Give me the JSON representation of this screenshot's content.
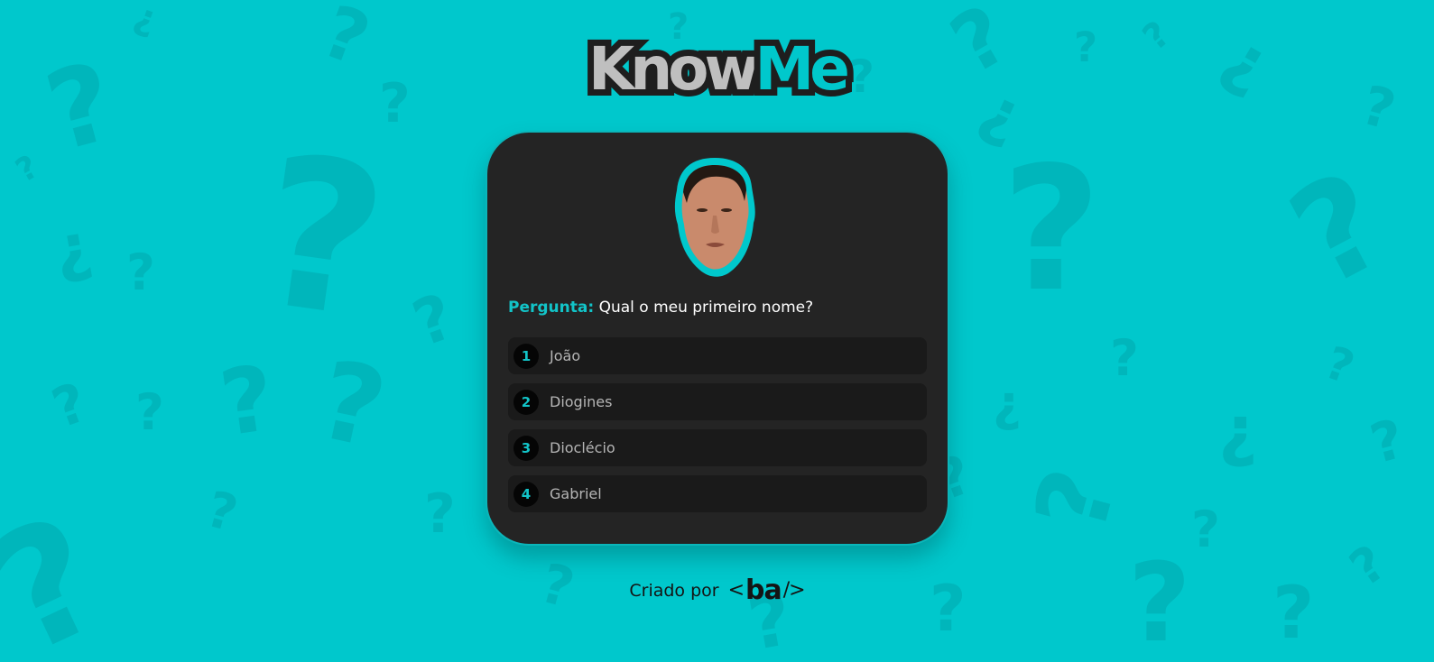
{
  "colors": {
    "background": "#00c8cc",
    "card": "#242424",
    "accent": "#12c4c8",
    "option_bg": "#1a1a1a",
    "logo_know": "#bfbfbf",
    "logo_outline": "#1e1e1e"
  },
  "header": {
    "logo_part1": "Know",
    "logo_part2": "Me"
  },
  "card": {
    "avatar_icon": "profile-photo",
    "question_label": "Pergunta:",
    "question_text": "Qual o meu primeiro nome?",
    "options": [
      {
        "number": "1",
        "label": "João"
      },
      {
        "number": "2",
        "label": "Diogines"
      },
      {
        "number": "3",
        "label": "Dioclécio"
      },
      {
        "number": "4",
        "label": "Gabriel"
      }
    ]
  },
  "footer": {
    "credit_text": "Criado por",
    "brand_open": "<",
    "brand_name": "ba",
    "brand_close": "/>"
  }
}
